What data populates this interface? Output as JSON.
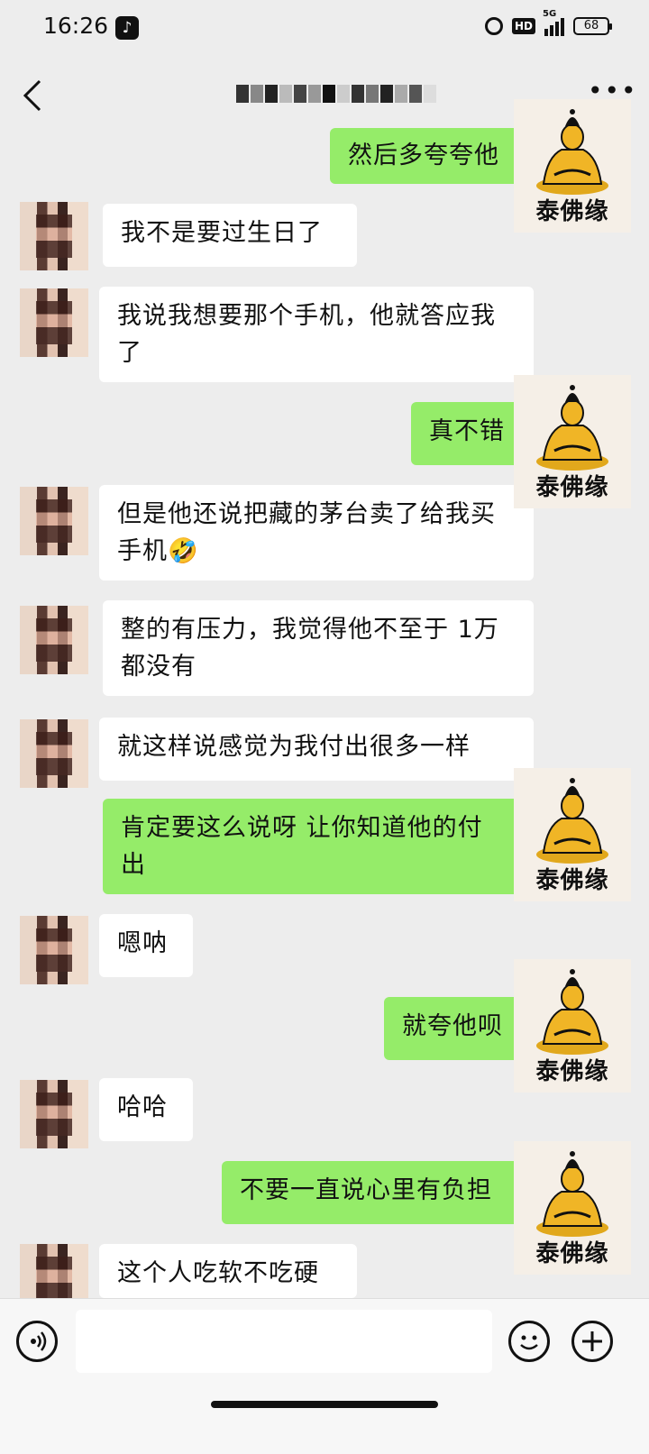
{
  "status_bar": {
    "time": "16:26",
    "hd": "HD",
    "network": "5G",
    "battery": "68"
  },
  "title_bar": {
    "back_icon": "chevron-left-icon",
    "more_icon": "more-dots-icon",
    "title_obscured": true
  },
  "watermark": {
    "text": "泰佛缘",
    "icon": "buddha-icon"
  },
  "messages": [
    {
      "side": "out",
      "text": "然后多夸夸他"
    },
    {
      "side": "in",
      "text": "我不是要过生日了"
    },
    {
      "side": "in",
      "text": "我说我想要那个手机，他就答应我了"
    },
    {
      "side": "out",
      "text": "真不错"
    },
    {
      "side": "in",
      "text": "但是他还说把藏的茅台卖了给我买手机🤣"
    },
    {
      "side": "in",
      "text": "整的有压力，我觉得他不至于 1万都没有"
    },
    {
      "side": "in",
      "text": "就这样说感觉为我付出很多一样"
    },
    {
      "side": "out",
      "text": "肯定要这么说呀  让你知道他的付出"
    },
    {
      "side": "in",
      "text": "嗯呐"
    },
    {
      "side": "out",
      "text": "就夸他呗"
    },
    {
      "side": "in",
      "text": "哈哈"
    },
    {
      "side": "out",
      "text": "不要一直说心里有负担"
    },
    {
      "side": "in",
      "text": "这个人吃软不吃硬"
    }
  ],
  "input_bar": {
    "voice_icon": "voice-icon",
    "input_value": "",
    "emoji_icon": "emoji-icon",
    "plus_icon": "plus-icon"
  }
}
